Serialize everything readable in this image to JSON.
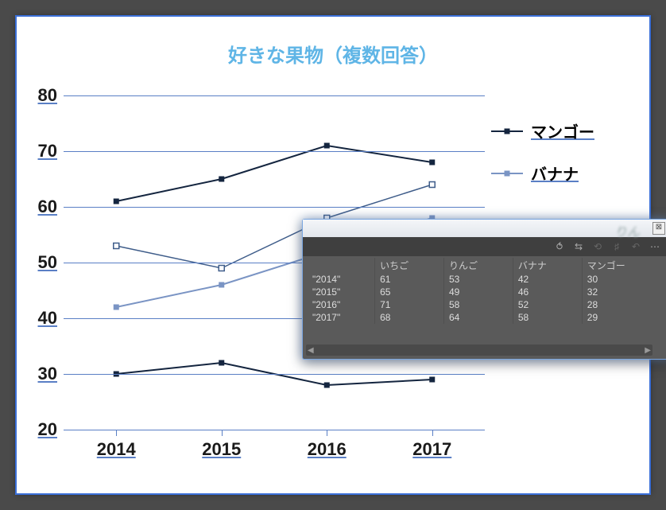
{
  "chart_data": {
    "type": "line",
    "title": "好きな果物（複数回答）",
    "categories": [
      "2014",
      "2015",
      "2016",
      "2017"
    ],
    "series": [
      {
        "name": "いちご",
        "values": [
          61,
          65,
          71,
          68
        ],
        "color": "#14253f",
        "marker": "square-filled"
      },
      {
        "name": "りんご",
        "values": [
          53,
          49,
          58,
          64
        ],
        "color": "#3f5d8a",
        "marker": "square-open"
      },
      {
        "name": "バナナ",
        "values": [
          42,
          46,
          52,
          58
        ],
        "color": "#7a94c4",
        "marker": "square-filled"
      },
      {
        "name": "マンゴー",
        "values": [
          30,
          32,
          28,
          29
        ],
        "color": "#14253f",
        "marker": "square-filled"
      }
    ],
    "xlabel": "",
    "ylabel": "",
    "ylim": [
      20,
      80
    ],
    "yticks": [
      20,
      30,
      40,
      50,
      60,
      70,
      80
    ]
  },
  "legend": {
    "items": [
      {
        "label": "マンゴー",
        "series_index": 3
      },
      {
        "label": "バナナ",
        "series_index": 2
      }
    ]
  },
  "data_panel": {
    "ghost_title": "りん",
    "columns": [
      "",
      "いちご",
      "りんご",
      "バナナ",
      "マンゴー"
    ],
    "rows": [
      [
        "\"2014\"",
        "61",
        "53",
        "42",
        "30"
      ],
      [
        "\"2015\"",
        "65",
        "49",
        "46",
        "32"
      ],
      [
        "\"2016\"",
        "71",
        "58",
        "52",
        "28"
      ],
      [
        "\"2017\"",
        "68",
        "64",
        "58",
        "29"
      ]
    ],
    "close_glyph": "⊠",
    "tools": [
      {
        "name": "transpose-icon",
        "glyph": "⥀",
        "enabled": true
      },
      {
        "name": "swap-axes-icon",
        "glyph": "⇆",
        "enabled": true
      },
      {
        "name": "link-icon",
        "glyph": "⟲",
        "enabled": false
      },
      {
        "name": "grid-icon",
        "glyph": "♯",
        "enabled": false
      },
      {
        "name": "undo-icon",
        "glyph": "↶",
        "enabled": false
      },
      {
        "name": "settings-icon",
        "glyph": "⋯",
        "enabled": true
      }
    ]
  }
}
